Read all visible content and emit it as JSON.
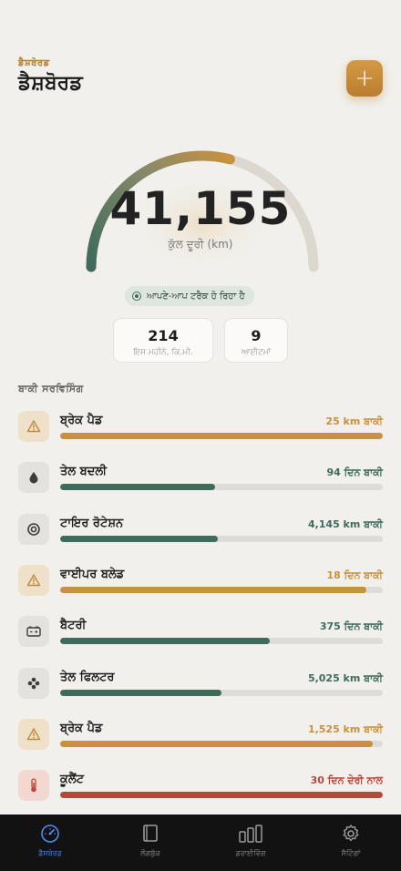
{
  "header": {
    "eyebrow": "ਡੈਸ਼ਬੋਰਡ",
    "title": "ਡੈਸ਼ਬੋਰਡ",
    "add_label": "+"
  },
  "odometer": {
    "value": "41,155",
    "label": "ਕੁੱਲ ਦੂਰੀ (km)"
  },
  "tracking": {
    "label": "ਆਪਣੇ-ਆਪ ਟਰੈਕ ਹੋ ਰਿਹਾ ਹੈ"
  },
  "stats": [
    {
      "value": "214",
      "label": "ਇਸ ਮਹੀਨੇ, ਕਿ.ਮੀ."
    },
    {
      "value": "9",
      "label": "ਆਈਟਮਾਂ"
    }
  ],
  "section": {
    "title": "ਬਾਕੀ ਸਰਵਿਸਿੰਗ"
  },
  "colors": {
    "gold": "#c8913f",
    "green": "#3f6b5c",
    "red": "#b9483a",
    "accent": "#4a8ef0"
  },
  "services": [
    {
      "name": "ਬ੍ਰੇਕ ਪੈਡ",
      "remaining": "25 km ਬਾਕੀ",
      "icon": "warning-icon",
      "status": "gold",
      "progress": 1.0
    },
    {
      "name": "ਤੇਲ ਬਦਲੀ",
      "remaining": "94 ਦਿਨ ਬਾਕੀ",
      "icon": "oil-drop-icon",
      "status": "green",
      "progress": 0.48
    },
    {
      "name": "ਟਾਇਰ ਰੋਟੇਸ਼ਨ",
      "remaining": "4,145 km ਬਾਕੀ",
      "icon": "tire-icon",
      "status": "green",
      "progress": 0.49
    },
    {
      "name": "ਵਾਈਪਰ ਬਲੇਡ",
      "remaining": "18 ਦਿਨ ਬਾਕੀ",
      "icon": "warning-icon",
      "status": "gold",
      "progress": 0.95
    },
    {
      "name": "ਬੈਟਰੀ",
      "remaining": "375 ਦਿਨ ਬਾਕੀ",
      "icon": "battery-icon",
      "status": "green",
      "progress": 0.65
    },
    {
      "name": "ਤੇਲ ਫਿਲਟਰ",
      "remaining": "5,025 km ਬਾਕੀ",
      "icon": "filter-icon",
      "status": "green",
      "progress": 0.5
    },
    {
      "name": "ਬ੍ਰੇਕ ਪੈਡ",
      "remaining": "1,525 km ਬਾਕੀ",
      "icon": "warning-icon",
      "status": "gold",
      "progress": 0.97
    },
    {
      "name": "ਕੂਲੈਂਟ",
      "remaining": "30 ਦਿਨ ਦੇਰੀ ਨਾਲ",
      "icon": "thermometer-icon",
      "status": "red",
      "progress": 1.0
    }
  ],
  "tabs": [
    {
      "label": "ਡੈਸ਼ਬੋਰਡ",
      "icon": "speedometer-icon",
      "active": true
    },
    {
      "label": "ਲੌਗਬੁੱਕ",
      "icon": "book-icon",
      "active": false
    },
    {
      "label": "ਡਰਾਈਵਿੰਗ",
      "icon": "bar-chart-icon",
      "active": false
    },
    {
      "label": "ਸੈਟਿੰਗਾਂ",
      "icon": "gear-icon",
      "active": false
    }
  ]
}
